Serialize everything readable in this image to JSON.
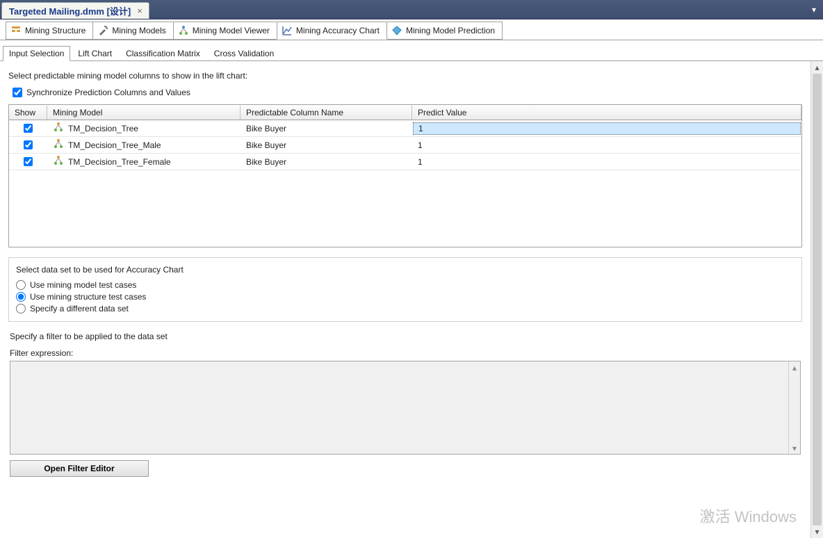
{
  "docTab": {
    "title": "Targeted Mailing.dmm [设计]"
  },
  "designerTabs": [
    {
      "label": "Mining Structure"
    },
    {
      "label": "Mining Models"
    },
    {
      "label": "Mining Model Viewer"
    },
    {
      "label": "Mining Accuracy Chart"
    },
    {
      "label": "Mining Model Prediction"
    }
  ],
  "subTabs": [
    {
      "label": "Input Selection"
    },
    {
      "label": "Lift Chart"
    },
    {
      "label": "Classification Matrix"
    },
    {
      "label": "Cross Validation"
    }
  ],
  "instruction": "Select predictable mining model columns to show in the lift chart:",
  "syncCheckbox": "Synchronize Prediction Columns and Values",
  "grid": {
    "headers": {
      "show": "Show",
      "model": "Mining Model",
      "pred": "Predictable Column Name",
      "val": "Predict Value"
    },
    "rows": [
      {
        "model": "TM_Decision_Tree",
        "pred": "Bike Buyer",
        "val": "1"
      },
      {
        "model": "TM_Decision_Tree_Male",
        "pred": "Bike Buyer",
        "val": "1"
      },
      {
        "model": "TM_Decision_Tree_Female",
        "pred": "Bike Buyer",
        "val": "1"
      }
    ]
  },
  "dataset": {
    "title": "Select data set to be used for Accuracy Chart",
    "opt1": "Use mining model test cases",
    "opt2": "Use mining structure test cases",
    "opt3": "Specify a different data set"
  },
  "filter": {
    "title": "Specify a filter to be applied to the data set",
    "label": "Filter expression:",
    "button": "Open Filter Editor"
  },
  "watermark": "激活 Windows"
}
